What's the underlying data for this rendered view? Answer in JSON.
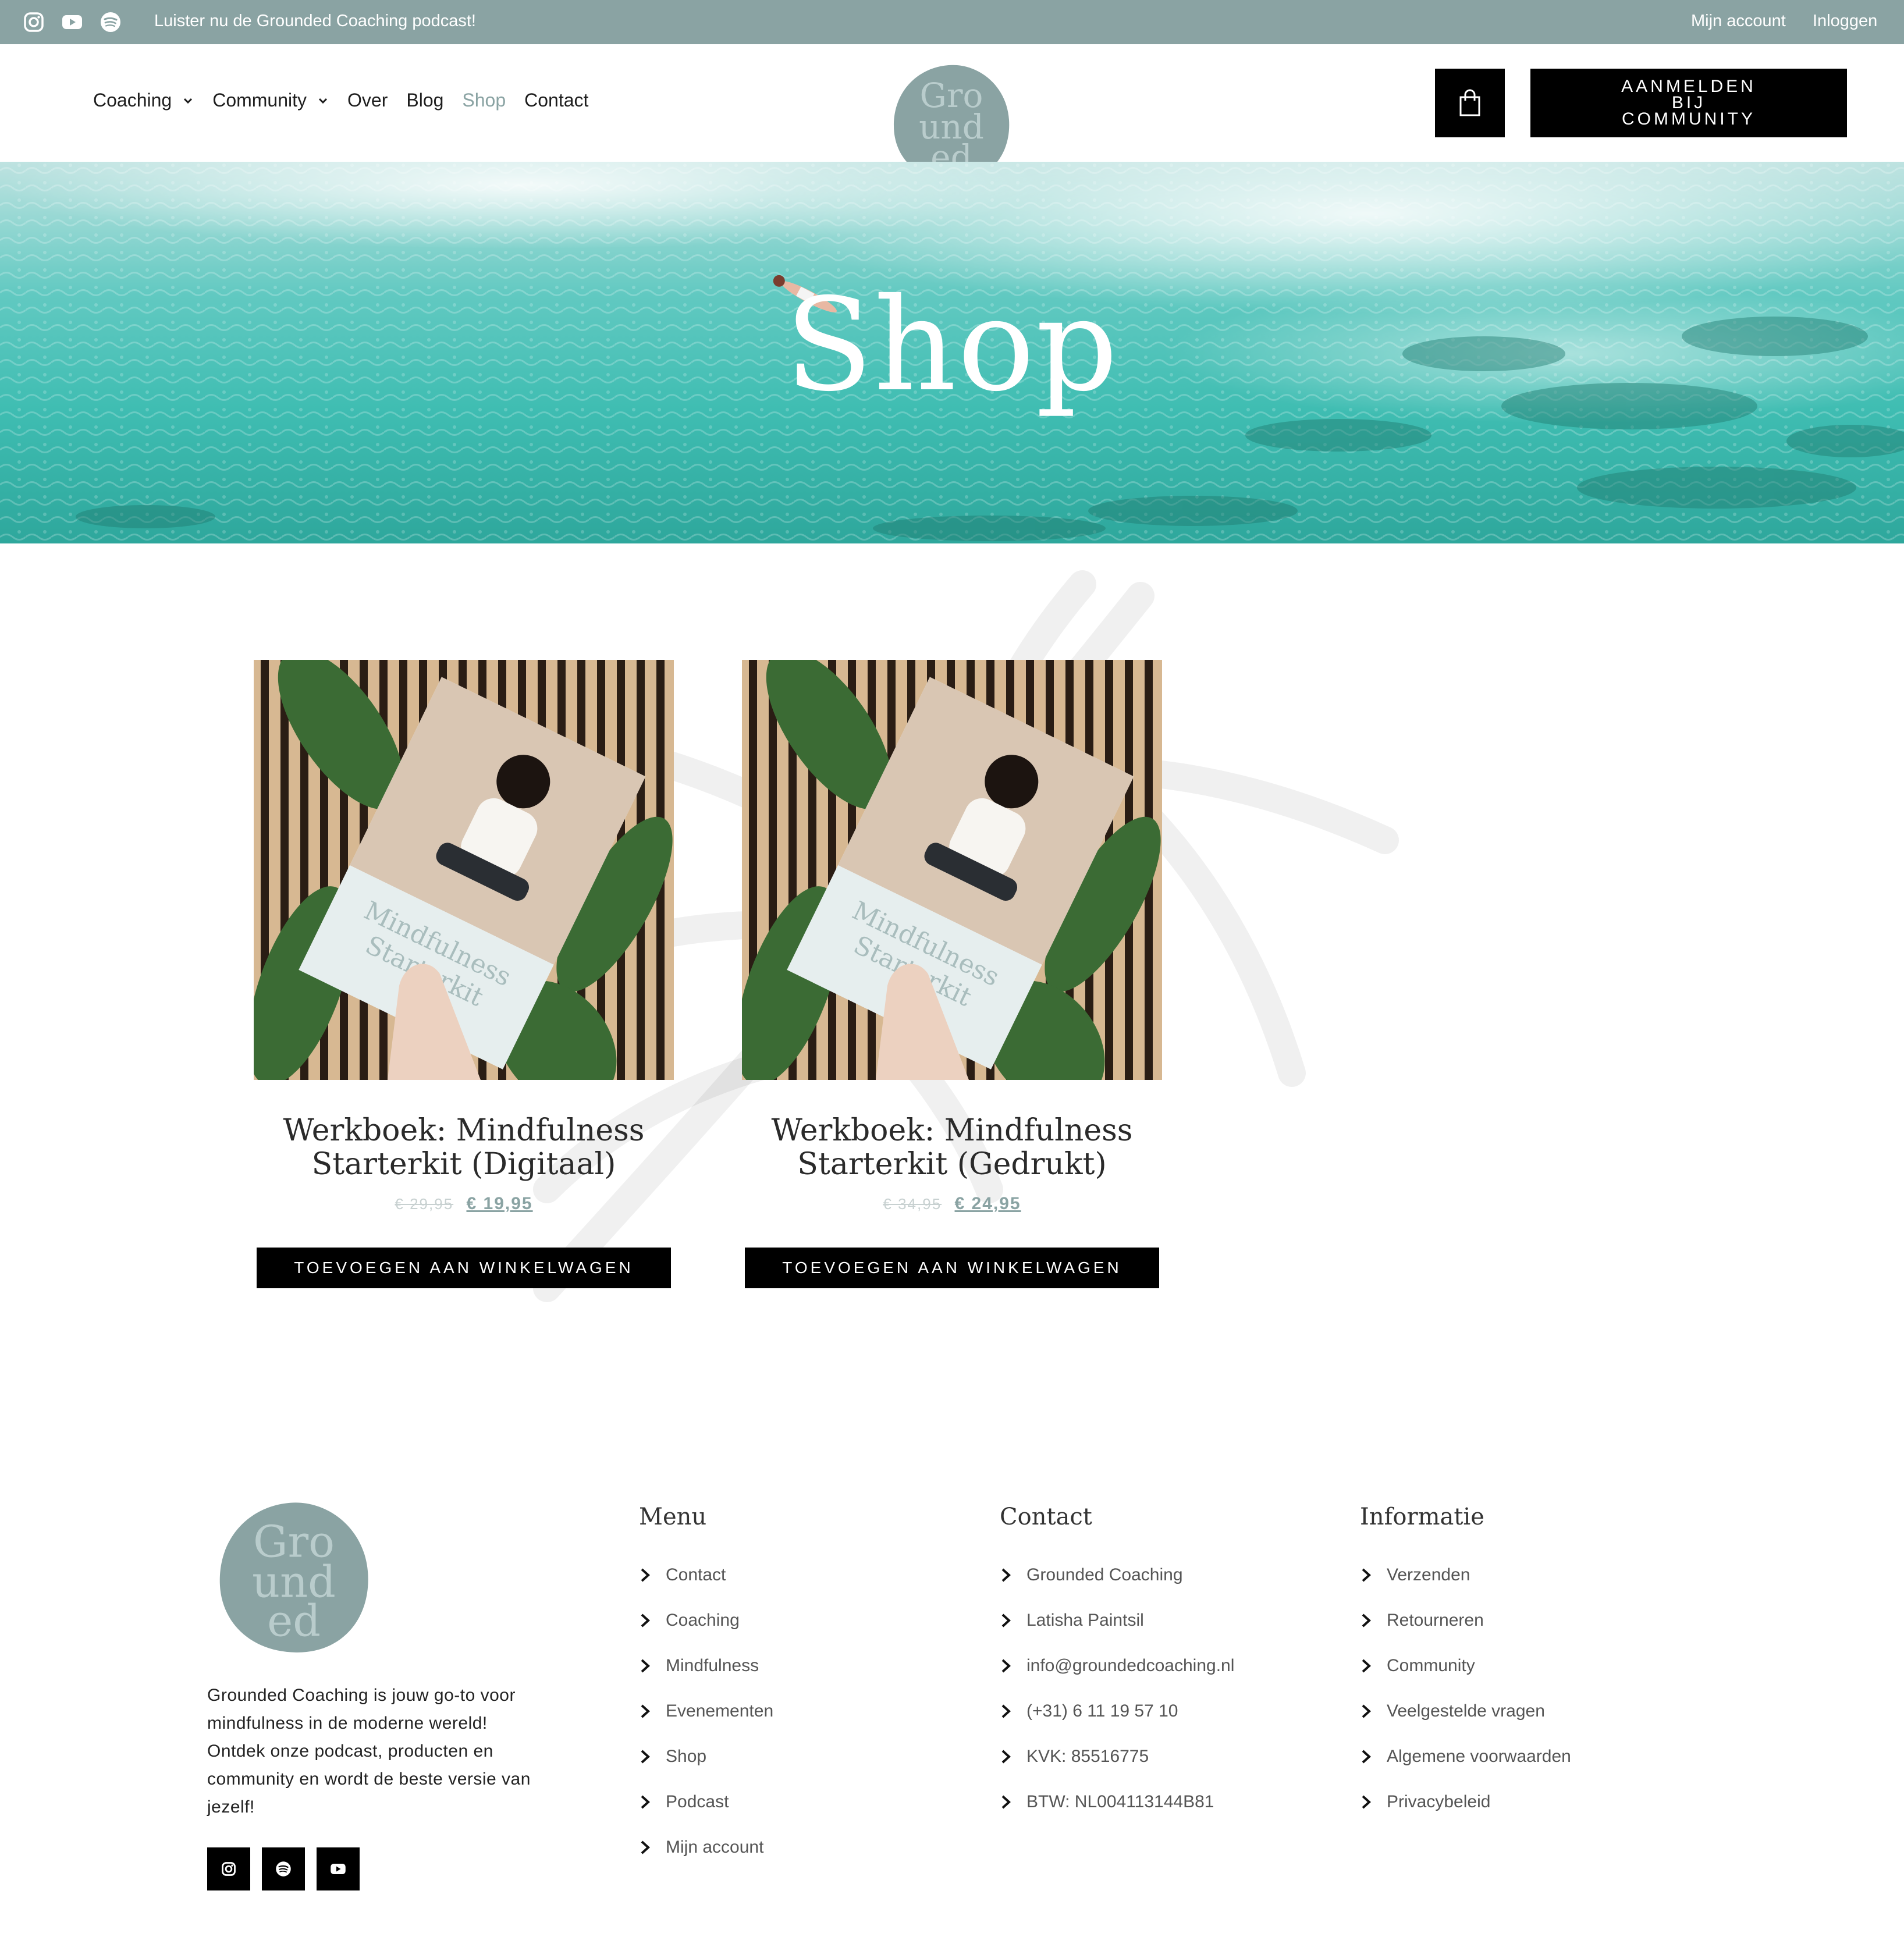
{
  "topbar": {
    "social_icons": [
      "instagram-icon",
      "youtube-icon",
      "spotify-icon"
    ],
    "announcement": "Luister nu de Grounded Coaching podcast!",
    "my_account": "Mijn account",
    "login": "Inloggen",
    "background": "#8aa3a3"
  },
  "header": {
    "nav": [
      {
        "label": "Coaching",
        "dropdown": true
      },
      {
        "label": "Community",
        "dropdown": true
      },
      {
        "label": "Over"
      },
      {
        "label": "Blog"
      },
      {
        "label": "Shop",
        "active": true
      },
      {
        "label": "Contact"
      }
    ],
    "logo_text": [
      "Gro",
      "und",
      "ed"
    ],
    "cart_icon": "shopping-bag-icon",
    "signup_label": "AANMELDEN BIJ COMMUNITY"
  },
  "hero": {
    "title": "Shop"
  },
  "products": [
    {
      "title": "Werkboek: Mindfulness Starterkit (Digitaal)",
      "old_price": "€ 29,95",
      "new_price": "€ 19,95",
      "button": "TOEVOEGEN AAN WINKELWAGEN"
    },
    {
      "title": "Werkboek: Mindfulness Starterkit (Gedrukt)",
      "old_price": "€ 34,95",
      "new_price": "€ 24,95",
      "button": "TOEVOEGEN AAN WINKELWAGEN"
    }
  ],
  "footer": {
    "about": "Grounded Coaching is jouw go-to voor mindfulness in de moderne wereld! Ontdek onze podcast, producten en community en wordt de beste versie van jezelf!",
    "social_icons": [
      "instagram-icon",
      "spotify-icon",
      "youtube-icon"
    ],
    "columns": [
      {
        "heading": "Menu",
        "items": [
          "Contact",
          "Coaching",
          "Mindfulness",
          "Evenementen",
          "Shop",
          "Podcast",
          "Mijn account"
        ]
      },
      {
        "heading": "Contact",
        "items": [
          "Grounded Coaching",
          "Latisha Paintsil",
          "info@groundedcoaching.nl",
          "(+31) 6 11 19 57 10",
          "KVK: 85516775",
          "BTW: NL004113144B81"
        ]
      },
      {
        "heading": "Informatie",
        "items": [
          "Verzenden",
          "Retourneren",
          "Community",
          "Veelgestelde vragen",
          "Algemene voorwaarden",
          "Privacybeleid"
        ]
      }
    ]
  },
  "colors": {
    "accent": "#8aa3a3",
    "button": "#000000"
  }
}
